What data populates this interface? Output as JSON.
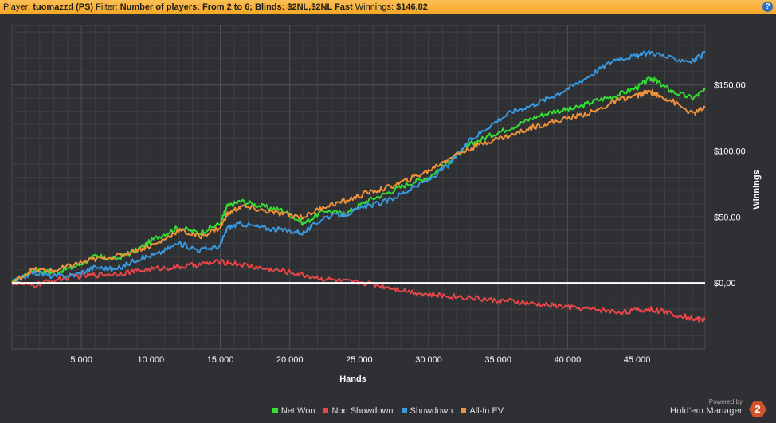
{
  "header": {
    "player_label": "Player:",
    "player_value": "tuomazzd (PS)",
    "filter_label": "Filter:",
    "filter_value": "Number of players: From 2 to 6; Blinds: $2NL,$2NL Fast",
    "winnings_label": "Winnings:",
    "winnings_value": "$146,82",
    "help_icon": "?"
  },
  "brand": {
    "powered_by": "Powered by",
    "name": "Hold'em Manager",
    "badge": "2"
  },
  "chart_data": {
    "type": "line",
    "xlabel": "Hands",
    "ylabel": "Winnings",
    "xlim": [
      0,
      49900
    ],
    "ylim": [
      -50,
      195
    ],
    "xticks": [
      5000,
      10000,
      15000,
      20000,
      25000,
      30000,
      35000,
      40000,
      45000
    ],
    "xtick_labels": [
      "5 000",
      "10 000",
      "15 000",
      "20 000",
      "25 000",
      "30 000",
      "35 000",
      "40 000",
      "45 000"
    ],
    "yticks": [
      0,
      50,
      100,
      150
    ],
    "ytick_labels": [
      "$0,00",
      "$50,00",
      "$100,00",
      "$150,00"
    ],
    "grid": true,
    "legend_position": "bottom",
    "zero_line_color": "#ffffff",
    "series": [
      {
        "name": "Net Won",
        "color": "#33dd33",
        "x": [
          0,
          1500,
          3000,
          4500,
          6000,
          7500,
          9000,
          10500,
          12000,
          13500,
          15000,
          15500,
          16500,
          18000,
          19500,
          21000,
          22500,
          24000,
          25500,
          27000,
          28500,
          30000,
          31500,
          33000,
          34500,
          36000,
          37500,
          39000,
          40500,
          42000,
          43500,
          45000,
          46000,
          46500,
          47500,
          49000,
          49900
        ],
        "y": [
          0,
          10,
          8,
          12,
          20,
          18,
          25,
          35,
          42,
          38,
          45,
          58,
          62,
          58,
          55,
          45,
          55,
          52,
          62,
          68,
          75,
          80,
          92,
          105,
          112,
          118,
          125,
          130,
          132,
          138,
          142,
          148,
          155,
          152,
          145,
          140,
          146
        ]
      },
      {
        "name": "Non Showdown",
        "color": "#e8474a",
        "x": [
          0,
          1500,
          3000,
          4500,
          6000,
          7500,
          9000,
          10500,
          12000,
          13500,
          15000,
          16500,
          18000,
          19500,
          21000,
          22500,
          24000,
          25500,
          27000,
          28500,
          30000,
          31500,
          33000,
          34500,
          36000,
          37500,
          39000,
          40500,
          42000,
          43500,
          45000,
          46000,
          47500,
          49000,
          49900
        ],
        "y": [
          0,
          -2,
          2,
          5,
          6,
          7,
          9,
          11,
          12,
          14,
          16,
          14,
          11,
          9,
          6,
          3,
          1,
          0,
          -3,
          -6,
          -9,
          -10,
          -11,
          -13,
          -14,
          -16,
          -17,
          -19,
          -20,
          -22,
          -21,
          -20,
          -23,
          -27,
          -28
        ]
      },
      {
        "name": "Showdown",
        "color": "#3898e0",
        "x": [
          0,
          1500,
          3000,
          4500,
          6000,
          7500,
          9000,
          10500,
          12000,
          13500,
          15000,
          15500,
          16500,
          18000,
          19500,
          21000,
          22500,
          24000,
          25500,
          27000,
          28500,
          30000,
          31500,
          33000,
          34500,
          36000,
          37500,
          39000,
          40500,
          42000,
          43500,
          45000,
          46000,
          47500,
          49000,
          49900
        ],
        "y": [
          0,
          8,
          5,
          6,
          12,
          10,
          18,
          22,
          30,
          25,
          28,
          42,
          45,
          42,
          40,
          38,
          50,
          52,
          58,
          62,
          70,
          78,
          90,
          108,
          120,
          130,
          135,
          142,
          150,
          160,
          170,
          172,
          175,
          170,
          168,
          174
        ]
      },
      {
        "name": "All-In EV",
        "color": "#f0923a",
        "x": [
          0,
          1500,
          3000,
          4500,
          6000,
          7500,
          9000,
          10500,
          12000,
          13500,
          15000,
          15500,
          16500,
          18000,
          19500,
          21000,
          22500,
          24000,
          25500,
          27000,
          28500,
          30000,
          31500,
          33000,
          34500,
          36000,
          37500,
          39000,
          40500,
          42000,
          43500,
          45000,
          46000,
          46500,
          47500,
          49000,
          49900
        ],
        "y": [
          0,
          10,
          9,
          14,
          18,
          20,
          25,
          30,
          40,
          35,
          42,
          52,
          58,
          55,
          52,
          50,
          58,
          62,
          68,
          72,
          78,
          85,
          95,
          102,
          108,
          112,
          118,
          122,
          126,
          130,
          138,
          142,
          145,
          142,
          138,
          128,
          133
        ]
      }
    ]
  }
}
